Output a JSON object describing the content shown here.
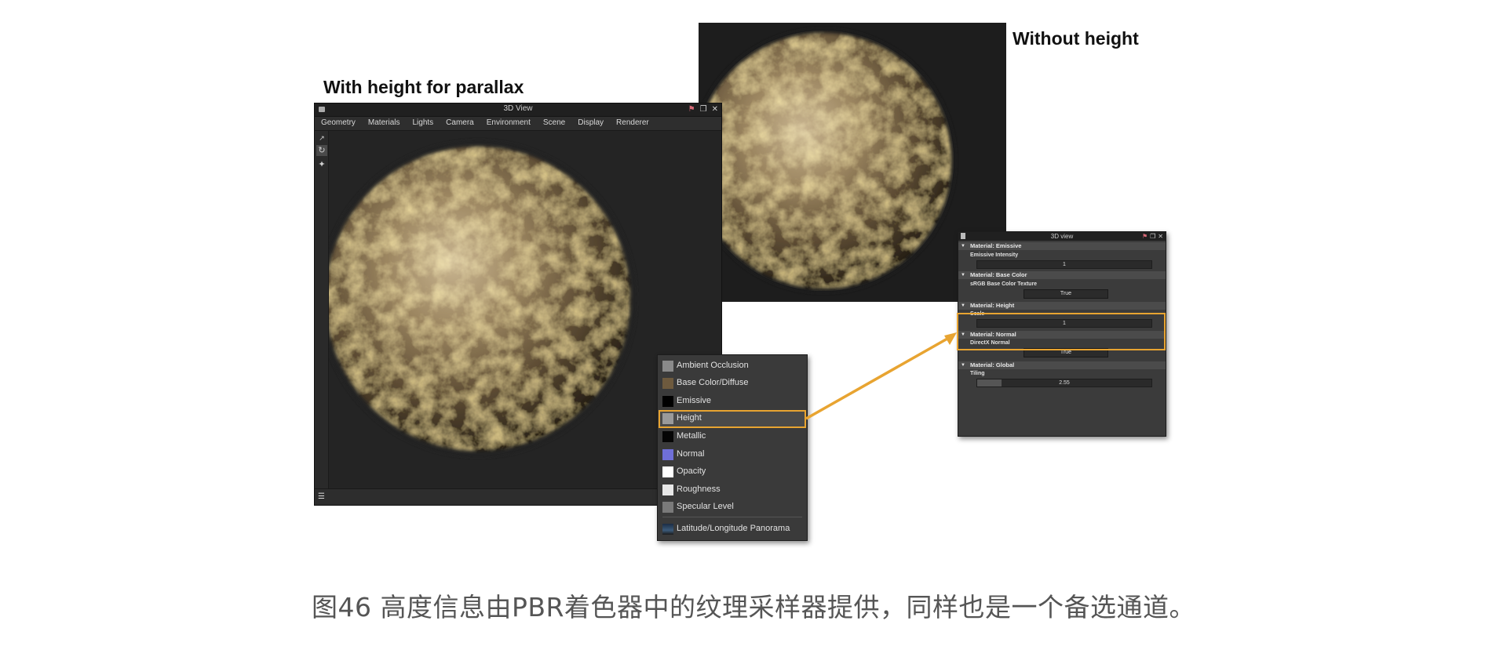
{
  "headings": {
    "with_height": "With height for parallax",
    "without_height": "Without height"
  },
  "view_window": {
    "title": "3D View",
    "menu": [
      "Geometry",
      "Materials",
      "Lights",
      "Camera",
      "Environment",
      "Scene",
      "Display",
      "Renderer"
    ]
  },
  "dropdown": {
    "items": [
      {
        "label": "Ambient Occlusion",
        "swatch": "#8a8a8a"
      },
      {
        "label": "Base Color/Diffuse",
        "swatch": "#6e5a3e"
      },
      {
        "label": "Emissive",
        "swatch": "#000000"
      },
      {
        "label": "Height",
        "swatch": "#9a9a9a"
      },
      {
        "label": "Metallic",
        "swatch": "#050505"
      },
      {
        "label": "Normal",
        "swatch": "#6f6fd8"
      },
      {
        "label": "Opacity",
        "swatch": "#ffffff"
      },
      {
        "label": "Roughness",
        "swatch": "#e8e8e8"
      },
      {
        "label": "Specular Level",
        "swatch": "#7a7a7a"
      },
      {
        "label": "Latitude/Longitude Panorama",
        "swatch": "#3b5a7a"
      }
    ],
    "selected": "Height"
  },
  "properties_panel": {
    "title": "3D view",
    "sections": {
      "emissive": {
        "header": "Material: Emissive",
        "label": "Emissive Intensity",
        "value": "1",
        "fill": 0.0
      },
      "base_color": {
        "header": "Material: Base Color",
        "label": "sRGB Base Color Texture",
        "value": "True"
      },
      "height": {
        "header": "Material: Height",
        "label": "Scale",
        "value": "1",
        "fill": 0.0
      },
      "normal": {
        "header": "Material: Normal",
        "label": "DirectX Normal",
        "value": "True"
      },
      "global": {
        "header": "Material: Global",
        "label": "Tiling",
        "value": "2.55",
        "fill": 0.14
      }
    }
  },
  "colors": {
    "highlight": "#e8a431"
  },
  "caption": "图46 高度信息由PBR着色器中的纹理采样器提供，同样也是一个备选通道。"
}
